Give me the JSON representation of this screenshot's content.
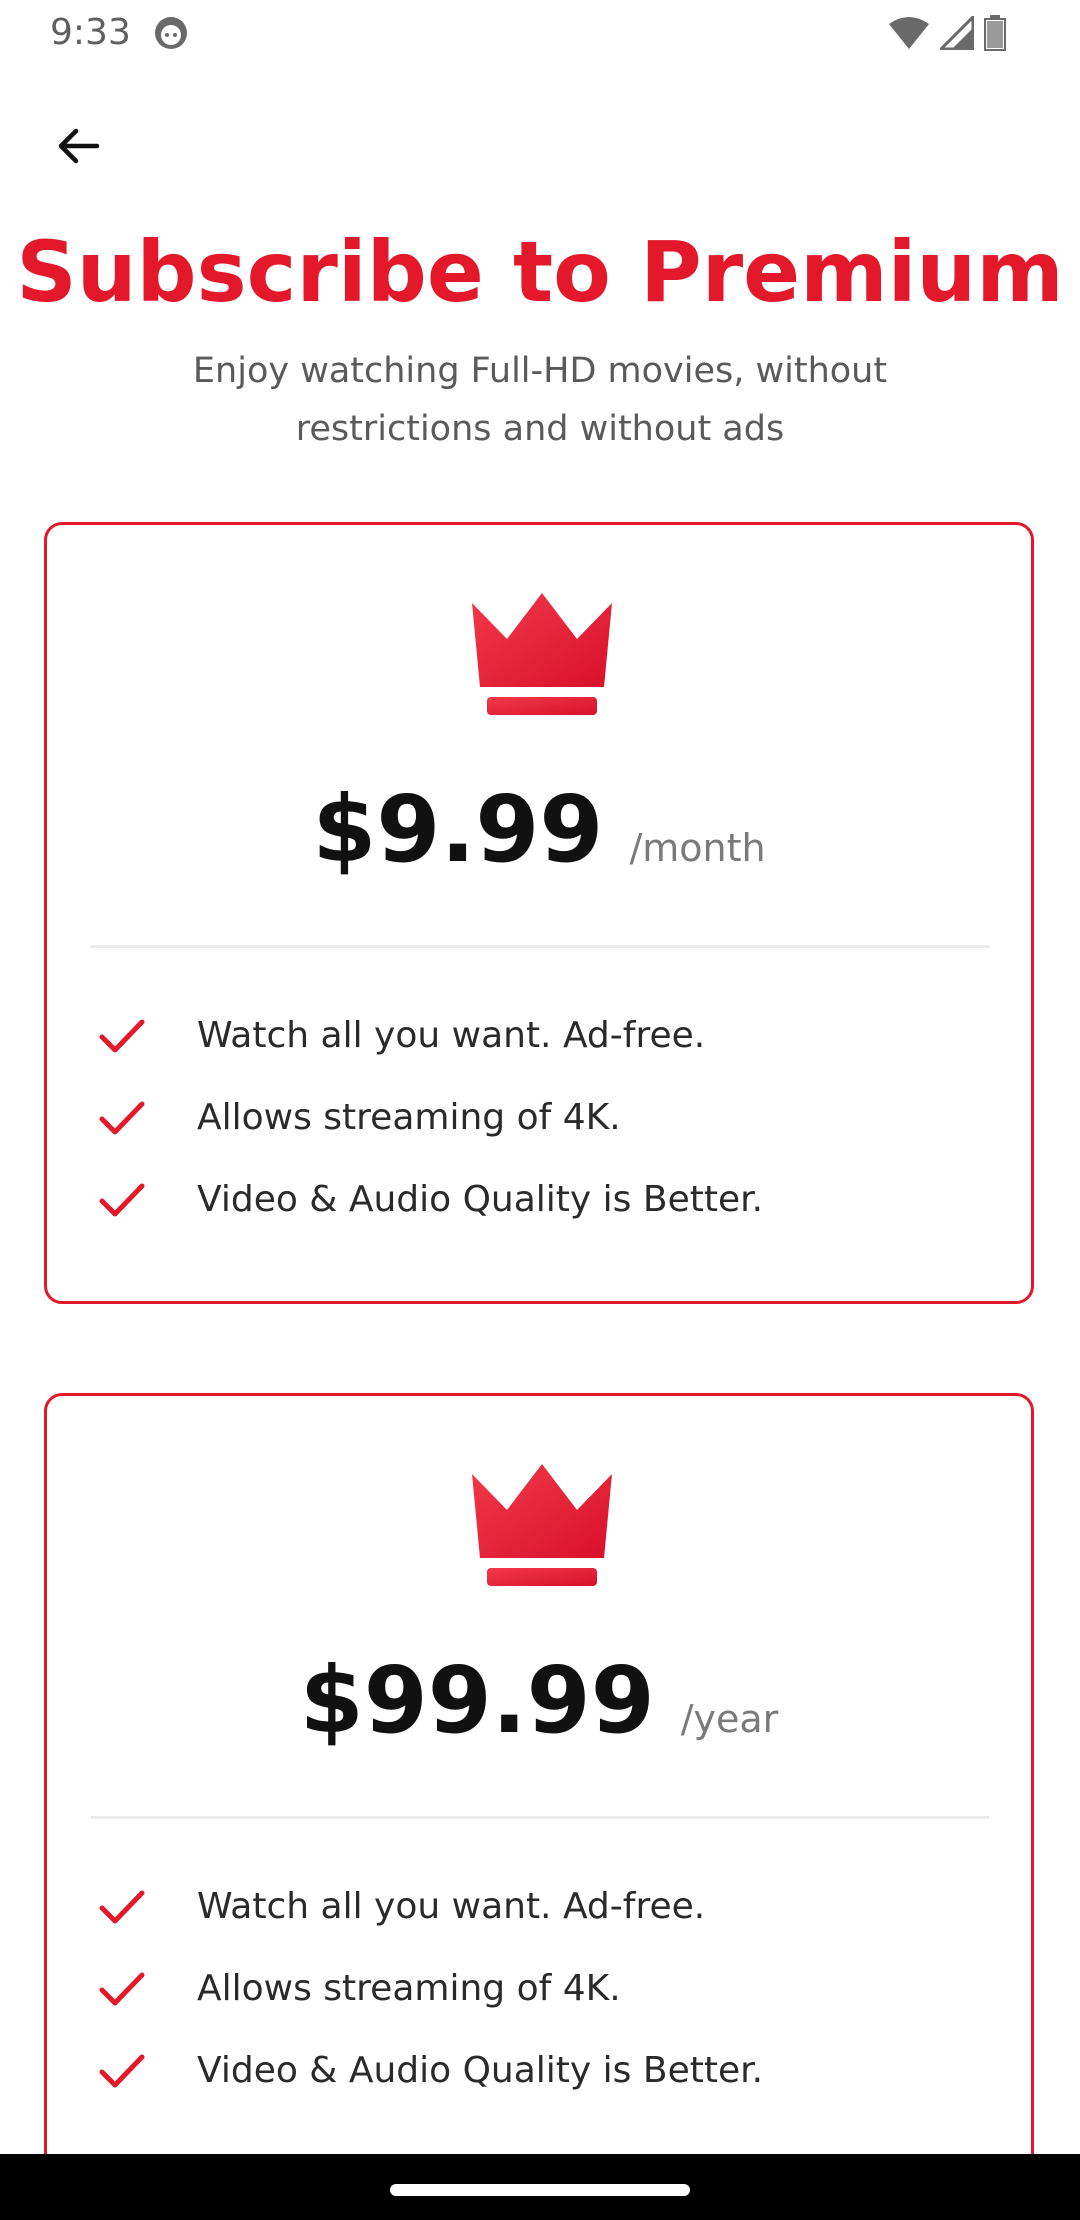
{
  "status_bar": {
    "time": "9:33"
  },
  "header": {
    "title": "Subscribe to Premium",
    "subtitle": "Enjoy watching Full-HD movies, without restrictions and without ads"
  },
  "colors": {
    "accent": "#e3192b",
    "text_dark": "#111111",
    "text_muted": "#7a7a7a"
  },
  "plans": [
    {
      "price": "$9.99",
      "period": "/month",
      "features": [
        "Watch all you want. Ad-free.",
        "Allows streaming of 4K.",
        "Video & Audio Quality is Better."
      ]
    },
    {
      "price": "$99.99",
      "period": "/year",
      "features": [
        "Watch all you want. Ad-free.",
        "Allows streaming of 4K.",
        "Video & Audio Quality is Better."
      ]
    }
  ],
  "icons": {
    "back": "arrow-left-icon",
    "crown": "crown-icon",
    "check": "check-icon"
  }
}
